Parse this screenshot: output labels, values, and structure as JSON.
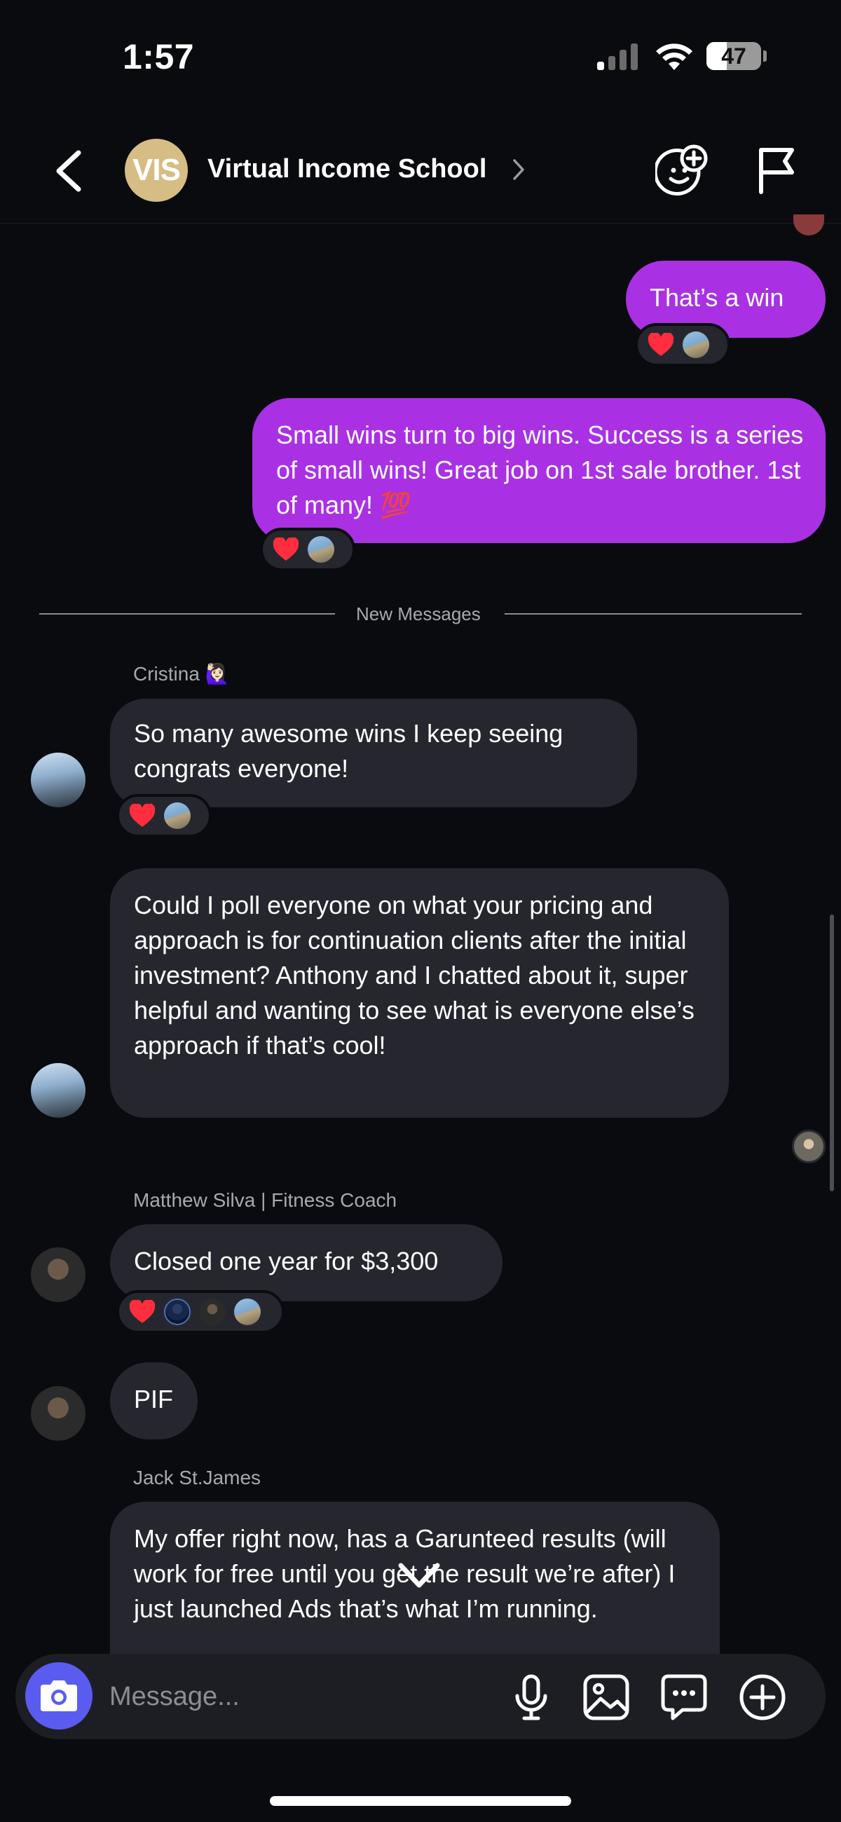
{
  "status_bar": {
    "time": "1:57",
    "battery": "47"
  },
  "header": {
    "group_avatar_text": "VIS",
    "title": "Virtual Income School"
  },
  "messages": {
    "out_1": "That’s a win",
    "out_2": "Small wins turn to big wins. Success is a series of small wins! Great job on 1st sale brother. 1st of many! 💯",
    "divider": "New Messages",
    "cristina_name": "Cristina 🙋🏻‍♀️",
    "cristina_1": "So many awesome wins I keep seeing congrats everyone!",
    "cristina_2": "Could I poll everyone on what your pricing and approach is for continuation clients after the initial investment? Anthony and I chatted about it, super helpful and wanting to see what is everyone else’s approach if that’s cool!",
    "matthew_name": "Matthew Silva | Fitness Coach",
    "matthew_1": "Closed one year for $3,300",
    "matthew_2": "PIF",
    "jack_name": "Jack St.James",
    "jack_1": "My offer right now, has a Garunteed results (will work for free until you get the result we’re after) I just launched Ads that’s what I’m running."
  },
  "composer": {
    "placeholder": "Message..."
  },
  "colors": {
    "background": "#0a0b0f",
    "outgoing_bubble": "#a931e3",
    "incoming_bubble": "#26272e",
    "camera_button": "#5a5cf0"
  },
  "icons": {
    "back": "chevron-left-icon",
    "title_chevron": "chevron-right-icon",
    "add_emoji": "emoji-add-icon",
    "report": "flag-icon",
    "camera": "camera-icon",
    "microphone": "microphone-icon",
    "gallery": "image-icon",
    "chat": "chat-bubble-icon",
    "plus": "plus-circle-icon",
    "scroll_down": "chevron-down-icon",
    "reaction": "heart-icon"
  }
}
